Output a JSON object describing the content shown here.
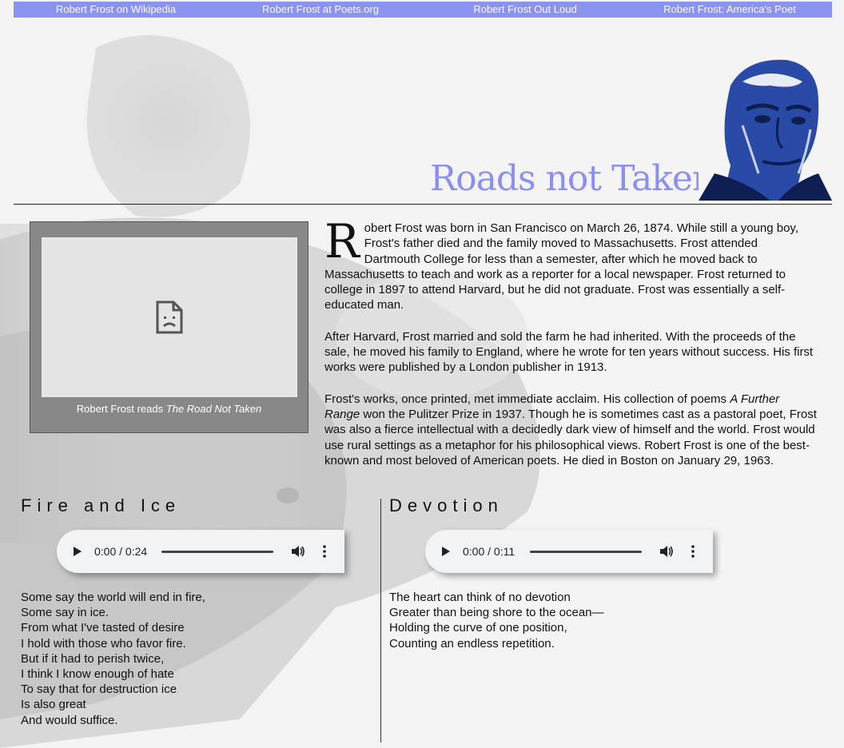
{
  "nav": {
    "links": [
      "Robert Frost on Wikipedia",
      "Robert Frost at Poets.org",
      "Robert Frost Out Loud",
      "Robert Frost: America's Poet"
    ]
  },
  "header": {
    "title": "Roads not Taken"
  },
  "video": {
    "caption_prefix": "Robert Frost reads ",
    "caption_title": "The Road Not Taken",
    "icon": "broken-document-icon"
  },
  "bio": {
    "dropcap": "R",
    "p1_rest": "obert Frost was born in San Francisco on March 26, 1874. While still a young boy, Frost's father died and the family moved to Massachusetts. Frost attended Dartmouth College for less than a semester, after which he moved back to Massachusetts to teach and work as a reporter for a local newspaper. Frost returned to college in 1897 to attend Harvard, but he did not graduate. Frost was essentially a self-educated man.",
    "p2": "After Harvard, Frost married and sold the farm he had inherited. With the proceeds of the sale, he moved his family to England, where he wrote for ten years without success. His first works were published by a London publisher in 1913.",
    "p3_a": "Frost's works, once printed, met immediate acclaim. His collection of poems ",
    "p3_em": "A Further Range",
    "p3_b": " won the Pulitzer Prize in 1937. Though he is sometimes cast as a pastoral poet, Frost was also a fierce intellectual with a decidedly dark view of himself and the world. Frost would use rural settings as a metaphor for his philosophical views. Robert Frost is one of the best-known and most beloved of American poets. He died in Boston on January 29, 1963."
  },
  "poems": {
    "fire": {
      "title": "Fire and Ice",
      "audio_time": "0:00 / 0:24",
      "lines": [
        "Some say the world will end in fire,",
        "Some say in ice.",
        "From what I've tasted of desire",
        "I hold with those who favor fire.",
        "But if it had to perish twice,",
        "I think I know enough of hate",
        "To say that for destruction ice",
        "Is also great",
        "And would suffice."
      ]
    },
    "devotion": {
      "title": "Devotion",
      "audio_time": "0:00 / 0:11",
      "lines": [
        "The heart can think of no devotion",
        "Greater than being shore to the ocean—",
        "Holding the curve of one position,",
        "Counting an endless repetition."
      ]
    }
  },
  "colors": {
    "nav": "#8b93f0",
    "title": "#8b8ff0",
    "portrait": "#1f3f9a"
  }
}
